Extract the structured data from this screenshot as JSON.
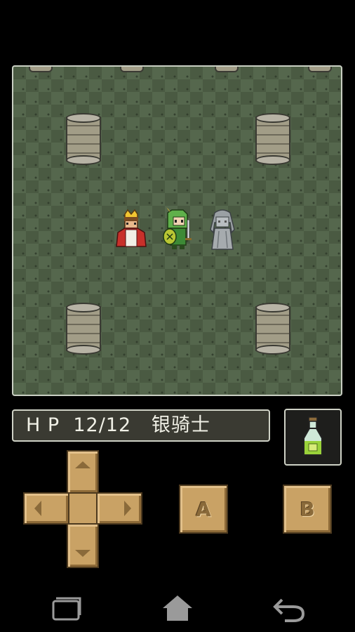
{
  "status": {
    "hp_label": "H P",
    "hp_value": "12/12",
    "character_name": "银骑士"
  },
  "controls": {
    "a_label": "A",
    "b_label": "B"
  },
  "icons": {
    "potion": "potion-icon",
    "dpad": "dpad",
    "recent": "recent-apps-icon",
    "home": "home-icon",
    "back": "back-icon"
  },
  "colors": {
    "floor": "#4a5a42",
    "button": "#c9a265",
    "status_bg": "#3a3a32"
  }
}
